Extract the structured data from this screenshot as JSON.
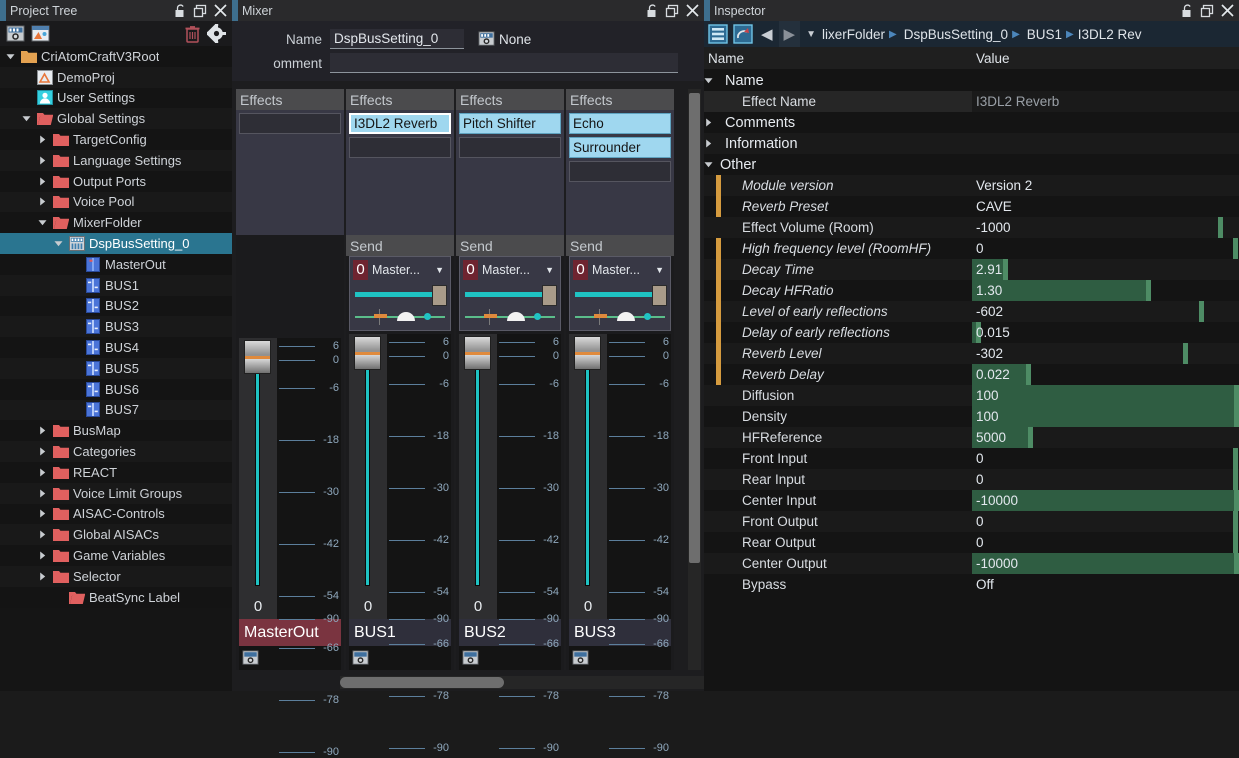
{
  "project_tree": {
    "title": "Project Tree",
    "window_buttons": [
      "unlock-icon",
      "restore-icon",
      "close-icon"
    ],
    "toolbar": {
      "left_icons": [
        "dsp-bus-setting-icon",
        "project-icon"
      ],
      "right_icons": [
        "trash-icon",
        "gear-icon"
      ]
    },
    "items": [
      {
        "label": "CriAtomCraftV3Root",
        "depth": 0,
        "twisty": "down",
        "icon": "folder-orange",
        "selected": false
      },
      {
        "label": "DemoProj",
        "depth": 1,
        "twisty": "none",
        "icon": "project-icon",
        "selected": false
      },
      {
        "label": "User Settings",
        "depth": 1,
        "twisty": "none",
        "icon": "user-icon",
        "selected": false
      },
      {
        "label": "Global Settings",
        "depth": 1,
        "twisty": "down",
        "icon": "folder-red-open",
        "selected": false
      },
      {
        "label": "TargetConfig",
        "depth": 2,
        "twisty": "right",
        "icon": "folder-red",
        "selected": false
      },
      {
        "label": "Language Settings",
        "depth": 2,
        "twisty": "right",
        "icon": "folder-red",
        "selected": false
      },
      {
        "label": "Output Ports",
        "depth": 2,
        "twisty": "right",
        "icon": "folder-red",
        "selected": false
      },
      {
        "label": "Voice Pool",
        "depth": 2,
        "twisty": "right",
        "icon": "folder-red",
        "selected": false
      },
      {
        "label": "MixerFolder",
        "depth": 2,
        "twisty": "down",
        "icon": "folder-red-open",
        "selected": false
      },
      {
        "label": "DspBusSetting_0",
        "depth": 3,
        "twisty": "down",
        "icon": "dsp-bus-setting-icon",
        "selected": true
      },
      {
        "label": "MasterOut",
        "depth": 4,
        "twisty": "none",
        "icon": "master-bus-icon",
        "selected": false
      },
      {
        "label": "BUS1",
        "depth": 4,
        "twisty": "none",
        "icon": "bus-icon",
        "selected": false
      },
      {
        "label": "BUS2",
        "depth": 4,
        "twisty": "none",
        "icon": "bus-icon",
        "selected": false
      },
      {
        "label": "BUS3",
        "depth": 4,
        "twisty": "none",
        "icon": "bus-icon",
        "selected": false
      },
      {
        "label": "BUS4",
        "depth": 4,
        "twisty": "none",
        "icon": "bus-icon",
        "selected": false
      },
      {
        "label": "BUS5",
        "depth": 4,
        "twisty": "none",
        "icon": "bus-icon",
        "selected": false
      },
      {
        "label": "BUS6",
        "depth": 4,
        "twisty": "none",
        "icon": "bus-icon",
        "selected": false
      },
      {
        "label": "BUS7",
        "depth": 4,
        "twisty": "none",
        "icon": "bus-icon",
        "selected": false
      },
      {
        "label": "BusMap",
        "depth": 2,
        "twisty": "right",
        "icon": "folder-red",
        "selected": false
      },
      {
        "label": "Categories",
        "depth": 2,
        "twisty": "right",
        "icon": "folder-red",
        "selected": false
      },
      {
        "label": "REACT",
        "depth": 2,
        "twisty": "right",
        "icon": "folder-red",
        "selected": false
      },
      {
        "label": "Voice Limit Groups",
        "depth": 2,
        "twisty": "right",
        "icon": "folder-red",
        "selected": false
      },
      {
        "label": "AISAC-Controls",
        "depth": 2,
        "twisty": "right",
        "icon": "folder-red",
        "selected": false
      },
      {
        "label": "Global AISACs",
        "depth": 2,
        "twisty": "right",
        "icon": "folder-red",
        "selected": false
      },
      {
        "label": "Game Variables",
        "depth": 2,
        "twisty": "right",
        "icon": "folder-red",
        "selected": false
      },
      {
        "label": "Selector",
        "depth": 2,
        "twisty": "right",
        "icon": "folder-red",
        "selected": false
      },
      {
        "label": "BeatSync Label",
        "depth": 3,
        "twisty": "none",
        "icon": "folder-red-open",
        "selected": false
      }
    ]
  },
  "mixer": {
    "title": "Mixer",
    "window_buttons": [
      "unlock-icon",
      "restore-icon",
      "close-icon"
    ],
    "name_label": "Name",
    "name_value": "DspBusSetting_0",
    "snapshot_label": "None",
    "comment_label": "omment",
    "comment_value": "",
    "comment_placeholder": "",
    "section_effects": "Effects",
    "section_send": "Send",
    "fader_ticks": [
      "6",
      "0",
      "-6",
      "-18",
      "-30",
      "-42",
      "-54",
      "-66",
      "-78",
      "-90"
    ],
    "strips": [
      {
        "name": "MasterOut",
        "is_master": true,
        "fader_value": "0",
        "effects": [
          {
            "label": "",
            "active": false,
            "focused": false
          }
        ],
        "has_send": false,
        "send": null
      },
      {
        "name": "BUS1",
        "is_master": false,
        "fader_value": "0",
        "effects": [
          {
            "label": "I3DL2 Reverb",
            "active": true,
            "focused": true
          },
          {
            "label": "",
            "active": false,
            "focused": false
          }
        ],
        "has_send": true,
        "send": {
          "index": "0",
          "target": "Master...",
          "level": "",
          "dropdown": "chevron-down-icon"
        }
      },
      {
        "name": "BUS2",
        "is_master": false,
        "fader_value": "0",
        "effects": [
          {
            "label": "Pitch Shifter",
            "active": true,
            "focused": false
          },
          {
            "label": "",
            "active": false,
            "focused": false
          }
        ],
        "has_send": true,
        "send": {
          "index": "0",
          "target": "Master...",
          "level": "",
          "dropdown": "chevron-down-icon"
        }
      },
      {
        "name": "BUS3",
        "is_master": false,
        "fader_value": "0",
        "effects": [
          {
            "label": "Echo",
            "active": true,
            "focused": false
          },
          {
            "label": "Surrounder",
            "active": true,
            "focused": false
          },
          {
            "label": "",
            "active": false,
            "focused": false
          }
        ],
        "has_send": true,
        "send": {
          "index": "0",
          "target": "Master...",
          "level": "",
          "dropdown": "chevron-down-icon"
        }
      }
    ]
  },
  "inspector": {
    "title": "Inspector",
    "window_buttons": [
      "unlock-icon",
      "restore-icon",
      "close-icon"
    ],
    "toolbar_icons": [
      "list-view-icon",
      "undo-icon"
    ],
    "nav_back": "◀",
    "nav_forward": "▶",
    "nav_dropdown": "▼",
    "breadcrumb": [
      {
        "label": "lixerFolder",
        "icon": "none"
      },
      {
        "label": "DspBusSetting_0",
        "icon": "dsp-bus-setting-icon"
      },
      {
        "label": "BUS1",
        "icon": "bus-icon"
      },
      {
        "label": "I3DL2 Rev",
        "icon": "none"
      }
    ],
    "columns": {
      "name": "Name",
      "value": "Value"
    },
    "rows": [
      {
        "kind": "group",
        "twisty": "down",
        "icon": "name-icon",
        "name": "Name",
        "value": ""
      },
      {
        "kind": "prop",
        "name": "Effect Name",
        "value": "I3DL2 Reverb",
        "dim": true,
        "italic": false,
        "plate": true,
        "bar": null
      },
      {
        "kind": "group",
        "twisty": "right",
        "icon": "comments-icon",
        "name": "Comments",
        "value": ""
      },
      {
        "kind": "group",
        "twisty": "right",
        "icon": "information-icon",
        "name": "Information",
        "value": ""
      },
      {
        "kind": "group",
        "twisty": "down",
        "icon": "none",
        "name": "Other",
        "value": ""
      },
      {
        "kind": "prop",
        "name": "Module version",
        "value": "Version 2",
        "dim": false,
        "italic": true,
        "mark": true,
        "bar": null
      },
      {
        "kind": "prop",
        "name": "Reverb Preset",
        "value": "CAVE",
        "dim": false,
        "italic": true,
        "mark": true,
        "bar": null
      },
      {
        "kind": "prop",
        "name": "Effect Volume (Room)",
        "value": "-1000",
        "dim": false,
        "italic": false,
        "bar": {
          "fill": 0,
          "cap": 94
        }
      },
      {
        "kind": "prop",
        "name": "High frequency level (RoomHF)",
        "value": "0",
        "dim": false,
        "italic": true,
        "mark": true,
        "bar": {
          "fill": 0,
          "cap": 99.5
        }
      },
      {
        "kind": "prop",
        "name": "Decay Time",
        "value": "2.91",
        "dim": false,
        "italic": true,
        "mark": true,
        "bar": {
          "fill": 13.5,
          "cap": 13.5
        }
      },
      {
        "kind": "prop",
        "name": "Decay HFRatio",
        "value": "1.30",
        "dim": false,
        "italic": true,
        "mark": true,
        "bar": {
          "fill": 67,
          "cap": 67
        }
      },
      {
        "kind": "prop",
        "name": "Level of early reflections",
        "value": "-602",
        "dim": false,
        "italic": true,
        "mark": true,
        "bar": {
          "fill": 0,
          "cap": 87
        }
      },
      {
        "kind": "prop",
        "name": "Delay of early reflections",
        "value": "0.015",
        "dim": false,
        "italic": true,
        "mark": true,
        "bar": {
          "fill": 3.5,
          "cap": 3.5
        }
      },
      {
        "kind": "prop",
        "name": "Reverb Level",
        "value": "-302",
        "dim": false,
        "italic": true,
        "mark": true,
        "bar": {
          "fill": 0,
          "cap": 81
        }
      },
      {
        "kind": "prop",
        "name": "Reverb Delay",
        "value": "0.022",
        "dim": false,
        "italic": true,
        "mark": true,
        "bar": {
          "fill": 22,
          "cap": 22
        }
      },
      {
        "kind": "prop",
        "name": "Diffusion",
        "value": "100",
        "dim": false,
        "italic": false,
        "bar": {
          "fill": 100,
          "cap": 100
        }
      },
      {
        "kind": "prop",
        "name": "Density",
        "value": "100",
        "dim": false,
        "italic": false,
        "bar": {
          "fill": 100,
          "cap": 100
        }
      },
      {
        "kind": "prop",
        "name": "HFReference",
        "value": "5000",
        "dim": false,
        "italic": false,
        "bar": {
          "fill": 23,
          "cap": 23
        }
      },
      {
        "kind": "prop",
        "name": "Front Input",
        "value": "0",
        "dim": false,
        "italic": false,
        "bar": {
          "fill": 0,
          "cap": 99.5
        }
      },
      {
        "kind": "prop",
        "name": "Rear Input",
        "value": "0",
        "dim": false,
        "italic": false,
        "bar": {
          "fill": 0,
          "cap": 99.5
        }
      },
      {
        "kind": "prop",
        "name": "Center Input",
        "value": "-10000",
        "dim": false,
        "italic": false,
        "bar": {
          "fill": 100,
          "cap": 100
        }
      },
      {
        "kind": "prop",
        "name": "Front Output",
        "value": "0",
        "dim": false,
        "italic": false,
        "bar": {
          "fill": 0,
          "cap": 99.5
        }
      },
      {
        "kind": "prop",
        "name": "Rear Output",
        "value": "0",
        "dim": false,
        "italic": false,
        "bar": {
          "fill": 0,
          "cap": 99.5
        }
      },
      {
        "kind": "prop",
        "name": "Center Output",
        "value": "-10000",
        "dim": false,
        "italic": false,
        "bar": {
          "fill": 100,
          "cap": 100
        }
      },
      {
        "kind": "prop",
        "name": "Bypass",
        "value": "Off",
        "dim": false,
        "italic": false,
        "bar": null
      }
    ]
  },
  "colors": {
    "selection": "#2a7590",
    "accent_blue": "#4c86bb",
    "fx_active": "#9fd7ef",
    "master_red": "#7a3440",
    "bar_green": "#2f5d42",
    "bar_cap": "#4e8c65",
    "fader_teal": "#1fc3c3",
    "orange_mark": "#d59b3f"
  }
}
